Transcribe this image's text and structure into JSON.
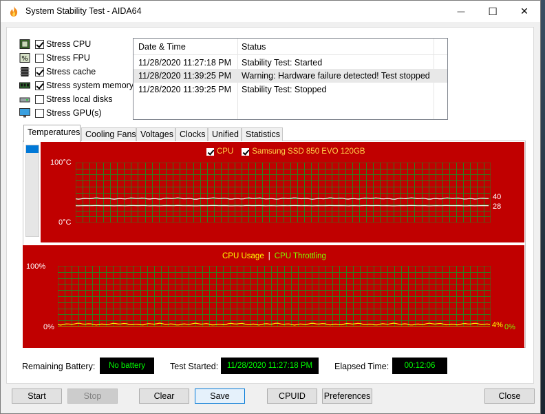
{
  "window": {
    "title": "System Stability Test - AIDA64"
  },
  "titlebar": {
    "minimize_glyph": "—",
    "maximize_glyph": "☐",
    "close_glyph": "✕"
  },
  "stress": [
    {
      "label": "Stress CPU",
      "checked": true,
      "icon": "cpu-chip-icon"
    },
    {
      "label": "Stress FPU",
      "checked": false,
      "icon": "fpu-percent-icon"
    },
    {
      "label": "Stress cache",
      "checked": true,
      "icon": "cache-chip-icon"
    },
    {
      "label": "Stress system memory",
      "checked": true,
      "icon": "memory-module-icon"
    },
    {
      "label": "Stress local disks",
      "checked": false,
      "icon": "disk-drive-icon"
    },
    {
      "label": "Stress GPU(s)",
      "checked": false,
      "icon": "monitor-icon"
    }
  ],
  "log": {
    "headers": [
      "Date & Time",
      "Status"
    ],
    "rows": [
      {
        "time": "11/28/2020 11:27:18 PM",
        "status": "Stability Test: Started",
        "selected": false
      },
      {
        "time": "11/28/2020 11:39:25 PM",
        "status": "Warning: Hardware failure detected! Test stopped",
        "selected": true
      },
      {
        "time": "11/28/2020 11:39:25 PM",
        "status": "Stability Test: Stopped",
        "selected": false
      }
    ]
  },
  "tabs": [
    "Temperatures",
    "Cooling Fans",
    "Voltages",
    "Clocks",
    "Unified",
    "Statistics"
  ],
  "active_tab": 0,
  "temp_graph": {
    "legend_cpu": "CPU",
    "legend_ssd": "Samsung SSD 850 EVO 120GB",
    "y_top": "100°C",
    "y_bottom": "0°C",
    "value_cpu": "40",
    "value_ssd": "28",
    "cpu_level": 40,
    "ssd_level": 28,
    "colors": {
      "bg": "#c00000",
      "grid": "#2e7d1e",
      "cpu_line": "#ffffff",
      "ssd_line": "#ffffff",
      "legend_text": "#ffd24a"
    }
  },
  "usage_graph": {
    "legend_usage": "CPU Usage",
    "legend_sep": "|",
    "legend_throttle": "CPU Throttling",
    "y_top": "100%",
    "y_bottom": "0%",
    "value_usage": "4%",
    "value_throttle": "0%",
    "usage_level": 4,
    "throttle_level": 0,
    "colors": {
      "bg": "#c00000",
      "grid": "#2e7d1e",
      "usage": "#ffff00",
      "throttle": "#7cfc00"
    }
  },
  "info": {
    "battery_label": "Remaining Battery:",
    "battery_value": "No battery",
    "started_label": "Test Started:",
    "started_value": "11/28/2020 11:27:18 PM",
    "elapsed_label": "Elapsed Time:",
    "elapsed_value": "00:12:06"
  },
  "buttons": {
    "start": "Start",
    "stop": "Stop",
    "clear": "Clear",
    "save": "Save",
    "cpuid": "CPUID",
    "preferences": "Preferences",
    "close": "Close"
  }
}
